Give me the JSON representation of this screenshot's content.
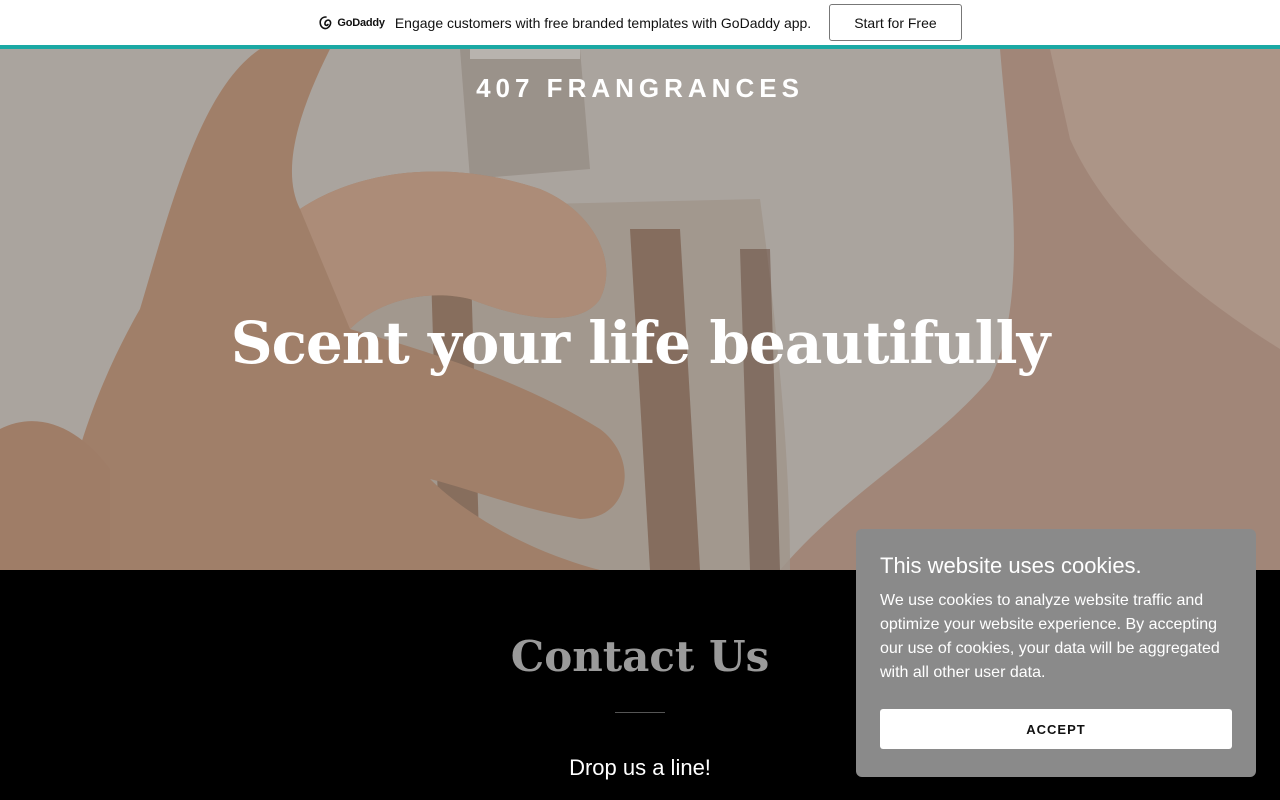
{
  "promo": {
    "logo_text": "GoDaddy",
    "message": "Engage customers with free branded templates with GoDaddy app.",
    "cta_label": "Start for Free"
  },
  "hero": {
    "brand": "407 FRANGRANCES",
    "tagline": "Scent your life beautifully"
  },
  "contact": {
    "title": "Contact Us",
    "subtitle": "Drop us a line!"
  },
  "cookie": {
    "title": "This website uses cookies.",
    "body": "We use cookies to analyze website traffic and optimize your website experience. By accepting our use of cookies, your data will be aggregated with all other user data.",
    "accept_label": "ACCEPT"
  },
  "colors": {
    "accent": "#1ba9a4",
    "cookie_bg": "#8a8a8a",
    "contact_bg": "#000000"
  }
}
